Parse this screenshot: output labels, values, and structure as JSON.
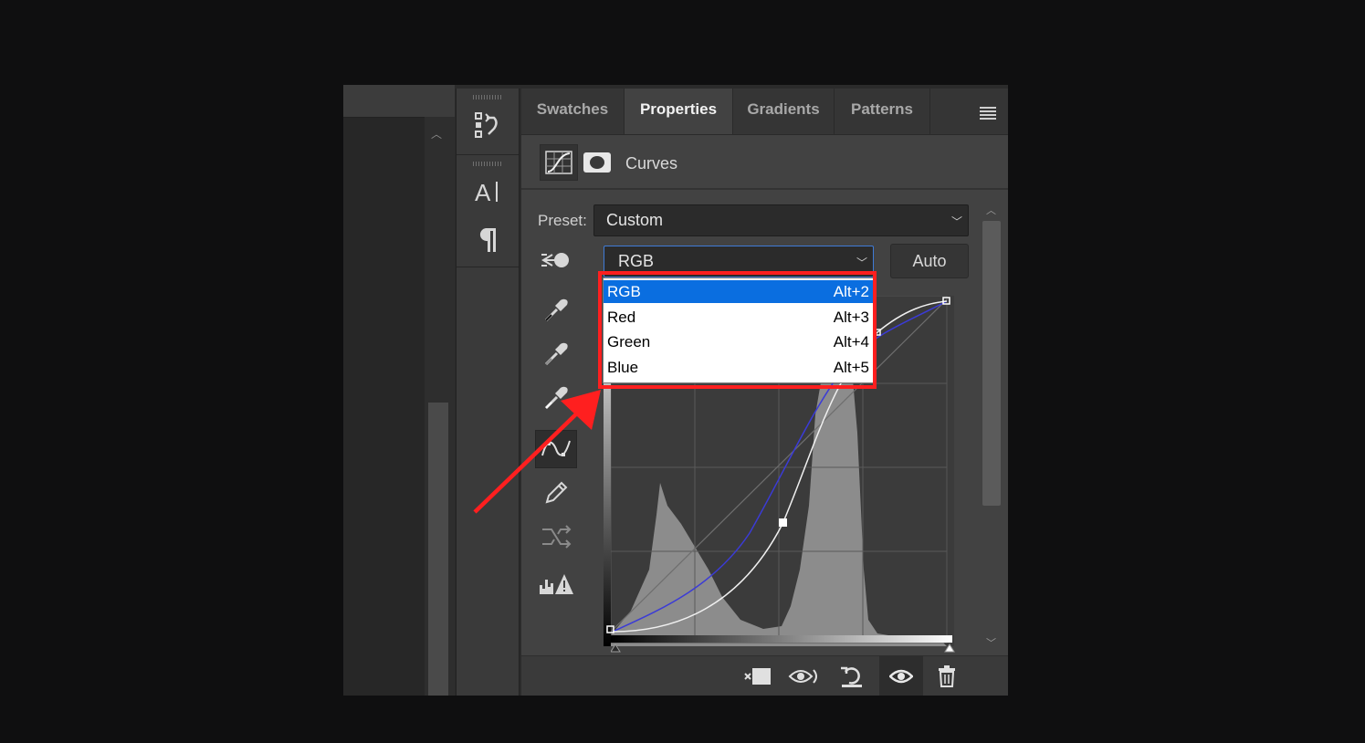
{
  "tabs": [
    {
      "label": "Swatches",
      "active": false
    },
    {
      "label": "Properties",
      "active": true
    },
    {
      "label": "Gradients",
      "active": false
    },
    {
      "label": "Patterns",
      "active": false
    }
  ],
  "header": {
    "title": "Curves"
  },
  "preset": {
    "label": "Preset:",
    "value": "Custom"
  },
  "channel": {
    "value": "RGB"
  },
  "auto_label": "Auto",
  "dropdown": {
    "options": [
      {
        "label": "RGB",
        "shortcut": "Alt+2",
        "selected": true
      },
      {
        "label": "Red",
        "shortcut": "Alt+3",
        "selected": false
      },
      {
        "label": "Green",
        "shortcut": "Alt+4",
        "selected": false
      },
      {
        "label": "Blue",
        "shortcut": "Alt+5",
        "selected": false
      }
    ]
  },
  "colors": {
    "annotation": "#ff1f1f",
    "selection": "#0a6ee0",
    "blue_curve": "#3b3bd6",
    "white_curve": "#f0f0f0"
  },
  "icons": [
    "history-icon",
    "character-icon",
    "paragraph-icon",
    "targeted-adjustment-icon",
    "black-eyedropper-icon",
    "gray-eyedropper-icon",
    "white-eyedropper-icon",
    "curve-points-icon",
    "pencil-icon",
    "smooth-icon",
    "clipping-warning-icon",
    "clip-to-layer-icon",
    "view-previous-icon",
    "reset-icon",
    "visibility-icon",
    "trash-icon"
  ]
}
